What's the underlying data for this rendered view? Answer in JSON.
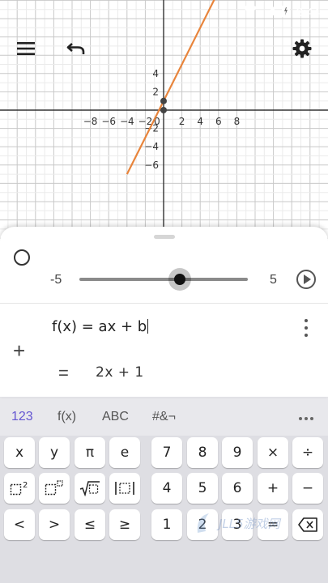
{
  "status_bar": {
    "time": "3:44"
  },
  "toolbar": {
    "menu_icon": "menu-icon",
    "undo_icon": "undo-icon",
    "settings_icon": "gear-icon"
  },
  "graph": {
    "x_ticks": [
      "−8",
      "−6",
      "−4",
      "−2",
      "0",
      "2",
      "4",
      "6",
      "8"
    ],
    "y_ticks": [
      "4",
      "2",
      "−2",
      "−4",
      "−6"
    ],
    "line_color": "#e8843b",
    "point_color": "#444444",
    "function": {
      "slope": 2,
      "intercept": 1
    },
    "points": [
      {
        "x": 0,
        "y": 0
      },
      {
        "x": 0,
        "y": 1
      }
    ],
    "x_range": [
      -9,
      9
    ],
    "y_range": [
      -6.2,
      6
    ]
  },
  "algebra": {
    "slider": {
      "min_label": "-5",
      "max_label": "5",
      "value": 1
    },
    "input_expression": "f(x) = ax + b",
    "equals": "=",
    "output": "2x + 1",
    "add_label": "+"
  },
  "keyboard": {
    "tabs": [
      "123",
      "f(x)",
      "ABC",
      "#&¬"
    ],
    "active_tab": "123",
    "rows": [
      [
        "x",
        "y",
        "π",
        "e",
        "7",
        "8",
        "9",
        "×",
        "÷"
      ],
      [
        "□²",
        "□ⁿ",
        "√□",
        "|□|",
        "4",
        "5",
        "6",
        "+",
        "−"
      ],
      [
        "<",
        ">",
        "≤",
        "≥",
        "1",
        "2",
        "3",
        "=",
        "⌫"
      ]
    ]
  },
  "watermark": "JLL5游戏网"
}
